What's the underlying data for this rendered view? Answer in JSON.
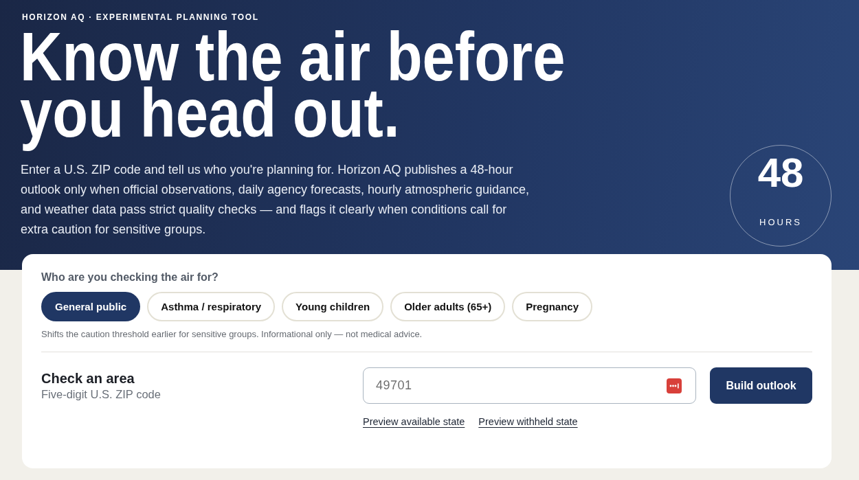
{
  "hero": {
    "eyebrow": "HORIZON AQ · EXPERIMENTAL PLANNING TOOL",
    "headline": "Know the air before you head out.",
    "intro": "Enter a U.S. ZIP code and tell us who you're planning for. Horizon AQ publishes a 48-hour outlook only when official observations, daily agency forecasts, hourly atmospheric guidance, and weather data pass strict quality checks — and flags it clearly when conditions call for extra caution for sensitive groups.",
    "badge": {
      "value": "48",
      "unit": "HOURS"
    }
  },
  "card": {
    "question": "Who are you checking the air for?",
    "audiences": [
      {
        "label": "General public",
        "selected": true
      },
      {
        "label": "Asthma / respiratory",
        "selected": false
      },
      {
        "label": "Young children",
        "selected": false
      },
      {
        "label": "Older adults (65+)",
        "selected": false
      },
      {
        "label": "Pregnancy",
        "selected": false
      }
    ],
    "hint": "Shifts the caution threshold earlier for sensitive groups. Informational only — not medical advice.",
    "area": {
      "title": "Check an area",
      "subtitle": "Five-digit U.S. ZIP code"
    },
    "zip_field": {
      "placeholder": "49701"
    },
    "submit_button": "Build outlook",
    "links": [
      "Preview available state",
      "Preview withheld state"
    ]
  }
}
